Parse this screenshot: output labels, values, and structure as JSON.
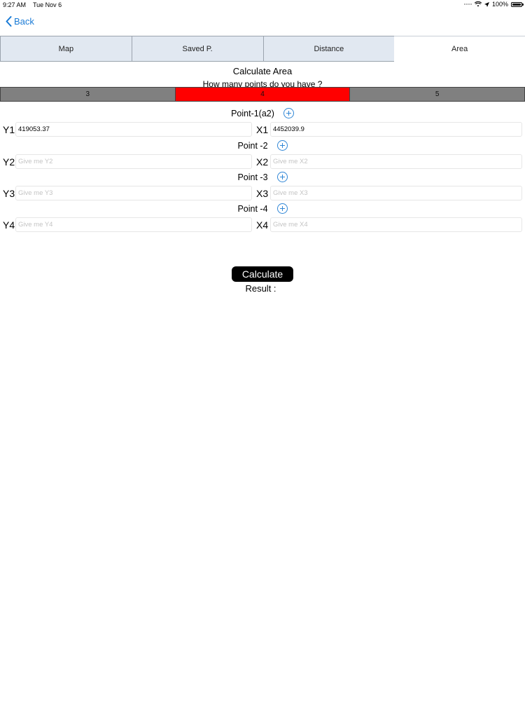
{
  "status_bar": {
    "time": "9:27 AM",
    "date": "Tue Nov 6",
    "battery": "100%"
  },
  "nav": {
    "back_label": "Back"
  },
  "tabs": [
    {
      "label": "Map",
      "active": false
    },
    {
      "label": "Saved P.",
      "active": false
    },
    {
      "label": "Distance",
      "active": false
    },
    {
      "label": "Area",
      "active": true
    }
  ],
  "header": {
    "title": "Calculate Area",
    "subtitle": "How many points do you have ?"
  },
  "segments": [
    {
      "label": "3",
      "selected": false
    },
    {
      "label": "4",
      "selected": true
    },
    {
      "label": "5",
      "selected": false
    }
  ],
  "points": [
    {
      "title": "Point-1(a2)",
      "y_label": "Y1",
      "y_value": "419053.37",
      "y_placeholder": "Give me Y1",
      "x_label": "X1",
      "x_value": "4452039.9",
      "x_placeholder": "Give me X1"
    },
    {
      "title": "Point -2",
      "y_label": "Y2",
      "y_value": "",
      "y_placeholder": "Give me Y2",
      "x_label": "X2",
      "x_value": "",
      "x_placeholder": "Give me X2"
    },
    {
      "title": "Point -3",
      "y_label": "Y3",
      "y_value": "",
      "y_placeholder": "Give me Y3",
      "x_label": "X3",
      "x_value": "",
      "x_placeholder": "Give me X3"
    },
    {
      "title": "Point -4",
      "y_label": "Y4",
      "y_value": "",
      "y_placeholder": "Give me Y4",
      "x_label": "X4",
      "x_value": "",
      "x_placeholder": "Give me X4"
    }
  ],
  "actions": {
    "calculate_label": "Calculate",
    "result_label": "Result :"
  },
  "colors": {
    "accent": "#1a7bd6",
    "segment_selected": "#ff0000",
    "segment_default": "#808080",
    "tab_inactive": "#e1e8f1"
  }
}
